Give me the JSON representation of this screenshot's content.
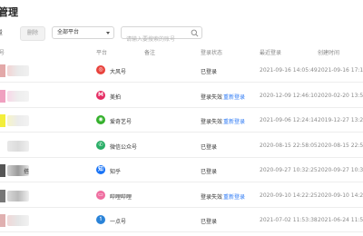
{
  "page": {
    "title": "管理"
  },
  "toolbar": {
    "left_cut_label": "量",
    "delete_label": "删除",
    "platform_select": "全部平台",
    "search_placeholder": "请输入要搜索的账号"
  },
  "table": {
    "headers": {
      "account": "号",
      "platform": "平台",
      "note": "备注",
      "status": "登录状态",
      "latest_login": "最近登录",
      "created": "创建时间"
    },
    "rows": [
      {
        "account": "",
        "platform": "大风号",
        "platform_icon": "dafeng-icon",
        "icon_color": "#e8423c",
        "icon_text": "◎",
        "status": "已登录",
        "relogin": "",
        "latest_login": "2021-09-16 14:05:49",
        "created": "2021-09-16 17:19"
      },
      {
        "account": "",
        "platform": "美拍",
        "platform_icon": "meipai-icon",
        "icon_color": "#e52e64",
        "icon_text": "M",
        "status": "登录失效",
        "relogin": "重新登录",
        "latest_login": "2020-12-09 12:46:10",
        "created": "2020-02-20 13:53"
      },
      {
        "account": "",
        "platform": "爱奇艺号",
        "platform_icon": "iqiyi-icon",
        "icon_color": "#34b02c",
        "icon_text": "◉",
        "status": "登录失效",
        "relogin": "重新登录",
        "latest_login": "2021-09-06 12:24:14",
        "created": "2019-12-27 13:22"
      },
      {
        "account": "",
        "platform": "微信公众号",
        "platform_icon": "wechat-icon",
        "icon_color": "#2aae67",
        "icon_text": "✆",
        "status": "已登录",
        "relogin": "",
        "latest_login": "2020-08-15 22:58:05",
        "created": "2020-08-15 22:56"
      },
      {
        "account": "搭",
        "platform": "知乎",
        "platform_icon": "zhihu-icon",
        "icon_color": "#1772f6",
        "icon_text": "知",
        "status": "已登录",
        "relogin": "",
        "latest_login": "2020-09-27 10:32:25",
        "created": "2020-09-27 10:32"
      },
      {
        "account": "",
        "platform": "哔哩哔哩",
        "platform_icon": "bilibili-icon",
        "icon_color": "#ef6ea0",
        "icon_text": "▭",
        "status": "登录失效",
        "relogin": "重新登录",
        "latest_login": "2020-09-10 14:22:25",
        "created": "2020-09-10 14:22"
      },
      {
        "account": "",
        "platform": "一点号",
        "platform_icon": "yidian-icon",
        "icon_color": "#2a83d8",
        "icon_text": "↿",
        "status": "已登录",
        "relogin": "",
        "latest_login": "2021-07-02 11:53:38",
        "created": "2021-06-24 11:53"
      }
    ]
  },
  "colors": {
    "link_blue": "#2f7bf5",
    "muted_gray": "#8a8a8a"
  }
}
